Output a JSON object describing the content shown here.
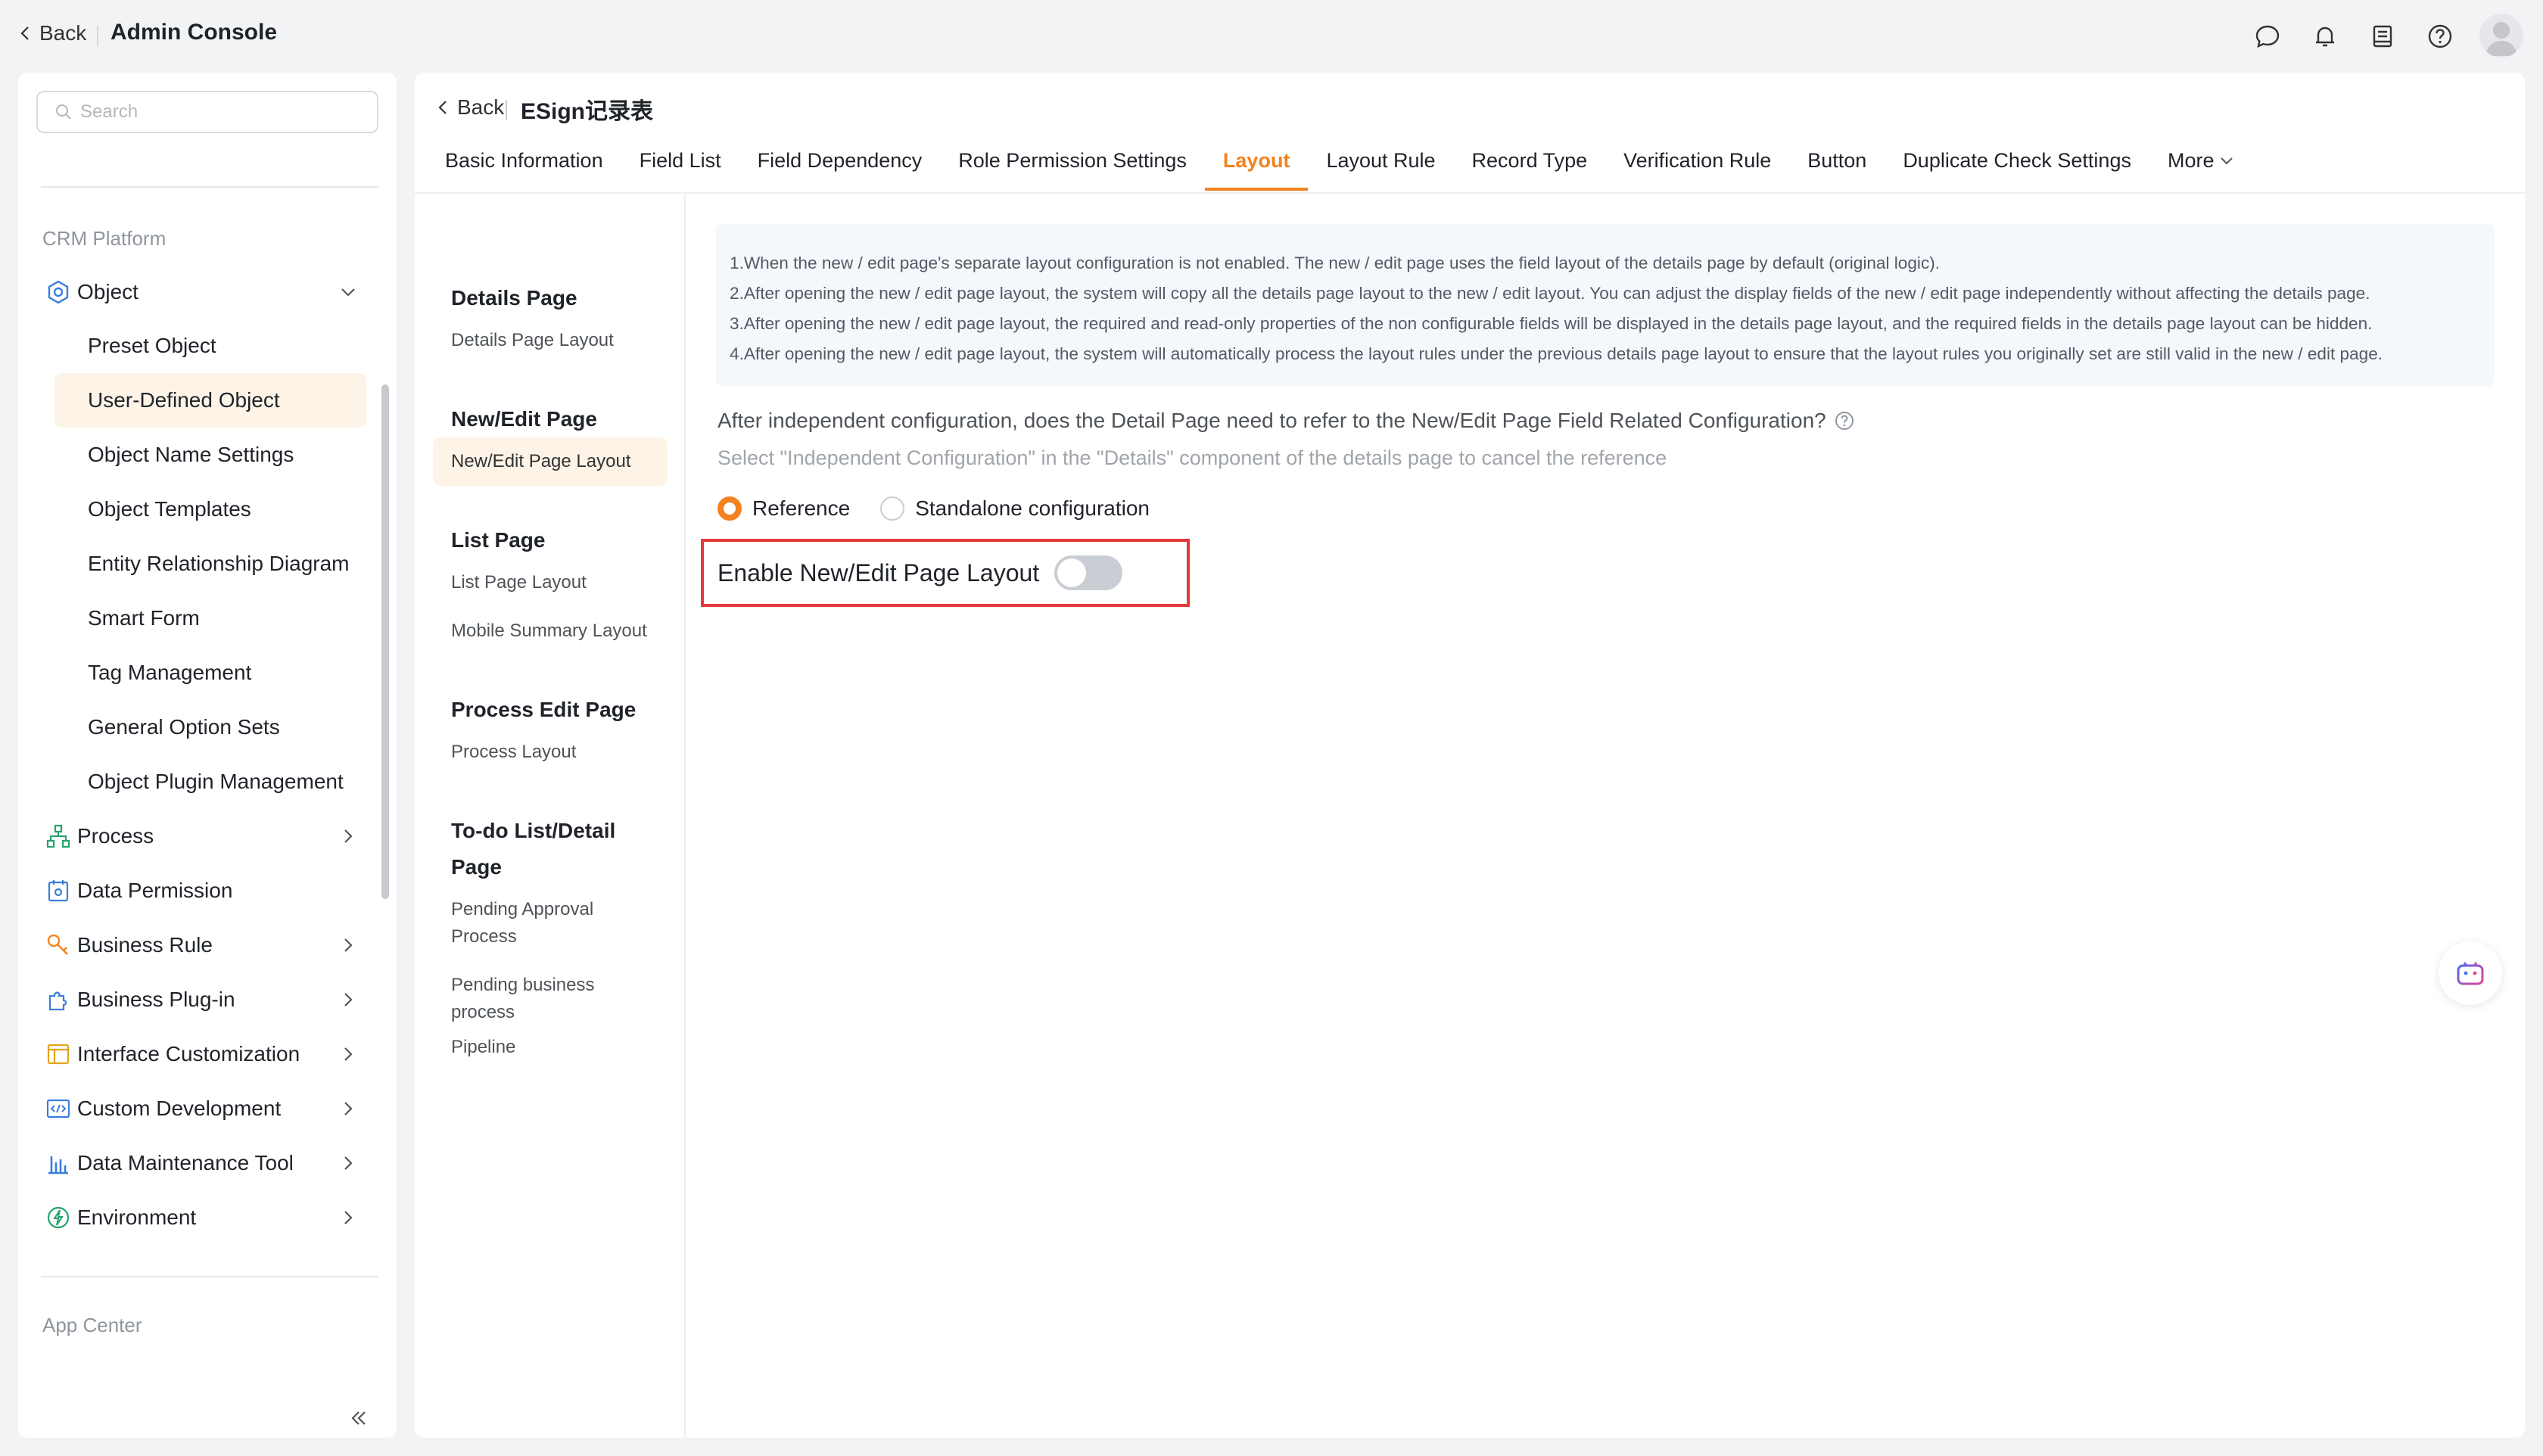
{
  "topbar": {
    "back_label": "Back",
    "title": "Admin Console",
    "icons": [
      "chat-icon",
      "bell-icon",
      "book-icon",
      "help-icon"
    ],
    "accent": "#f58220"
  },
  "sidebar": {
    "search_placeholder": "Search",
    "section_crm": "CRM Platform",
    "object_label": "Object",
    "sub_items": [
      {
        "label": "Preset Object"
      },
      {
        "label": "User-Defined Object"
      },
      {
        "label": "Object Name Settings"
      },
      {
        "label": "Object Templates"
      },
      {
        "label": "Entity Relationship Diagram"
      },
      {
        "label": "Smart Form"
      },
      {
        "label": "Tag Management"
      },
      {
        "label": "General Option Sets"
      },
      {
        "label": "Object Plugin Management"
      }
    ],
    "items": [
      {
        "label": "Process",
        "icon": "process-icon"
      },
      {
        "label": "Data Permission",
        "icon": "data-permission-icon"
      },
      {
        "label": "Business Rule",
        "icon": "business-rule-icon"
      },
      {
        "label": "Business Plug-in",
        "icon": "plugin-icon"
      },
      {
        "label": "Interface Customization",
        "icon": "interface-icon"
      },
      {
        "label": "Custom Development",
        "icon": "code-icon"
      },
      {
        "label": "Data Maintenance Tool",
        "icon": "chart-icon"
      },
      {
        "label": "Environment",
        "icon": "environment-icon"
      }
    ],
    "section_app": "App Center"
  },
  "main": {
    "back_label": "Back",
    "title": "ESign记录表",
    "tabs": [
      {
        "label": "Basic Information"
      },
      {
        "label": "Field List"
      },
      {
        "label": "Field Dependency"
      },
      {
        "label": "Role Permission Settings"
      },
      {
        "label": "Layout"
      },
      {
        "label": "Layout Rule"
      },
      {
        "label": "Record Type"
      },
      {
        "label": "Verification Rule"
      },
      {
        "label": "Button"
      },
      {
        "label": "Duplicate Check Settings"
      },
      {
        "label": "More"
      }
    ],
    "active_tab": "Layout",
    "subnav": {
      "details_group": "Details Page",
      "details_layout": "Details Page Layout",
      "newedit_group": "New/Edit Page",
      "newedit_layout": "New/Edit Page Layout",
      "list_group": "List Page",
      "list_layout": "List Page Layout",
      "mobile_summary": "Mobile Summary Layout",
      "process_group": "Process Edit Page",
      "process_layout": "Process Layout",
      "todo_group": "To-do List/Detail Page",
      "pending_approval": "Pending Approval Process",
      "pending_business": "Pending business process",
      "pipeline": "Pipeline"
    },
    "notice": [
      "1.When the new / edit page's separate layout configuration is not enabled. The new / edit page uses the field layout of the details page by default (original logic).",
      "2.After opening the new / edit page layout, the system will copy all the details page layout to the new / edit layout. You can adjust the display fields of the new / edit page independently without affecting the details page.",
      "3.After opening the new / edit page layout, the required and read-only properties of the non configurable fields will be displayed in the details page layout, and the required fields in the details page layout can be hidden.",
      "4.After opening the new / edit page layout, the system will automatically process the layout rules under the previous details page layout to ensure that the layout rules you originally set are still valid in the new / edit page."
    ],
    "question": "After independent configuration, does the Detail Page need to refer to the New/Edit Page Field Related Configuration?",
    "hint": "Select \"Independent Configuration\" in the \"Details\" component of the details page to cancel the reference",
    "radio_reference": "Reference",
    "radio_standalone": "Standalone configuration",
    "radio_selected": "Reference",
    "toggle_label": "Enable New/Edit Page Layout",
    "toggle_on": false
  }
}
